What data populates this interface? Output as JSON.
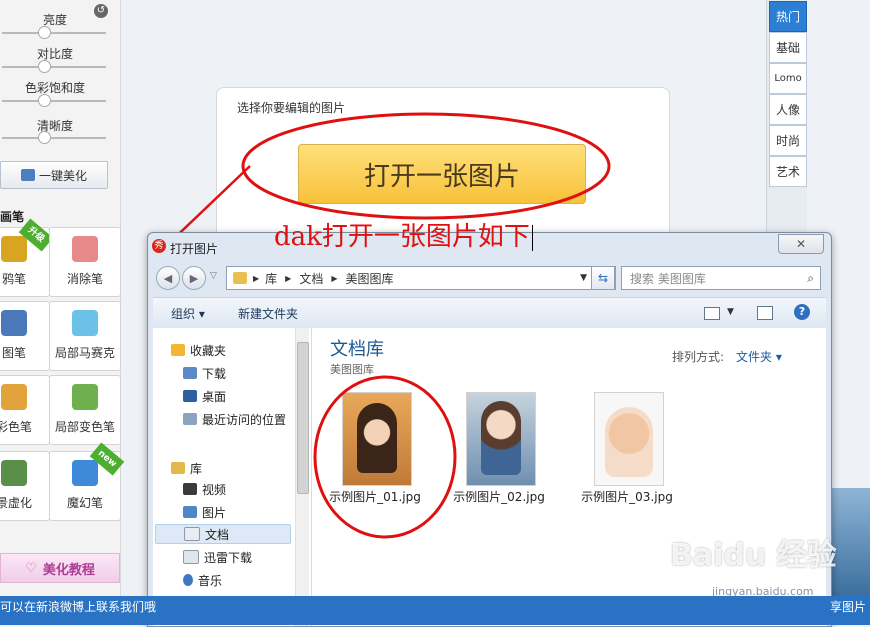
{
  "sliders": [
    {
      "label": "亮度",
      "level": 0.4
    },
    {
      "label": "对比度",
      "level": 0.4
    },
    {
      "label": "色彩饱和度",
      "level": 0.4
    },
    {
      "label": "清晰度",
      "level": 0.4
    }
  ],
  "onekey_label": "一键美化",
  "brush_title": "画笔",
  "tools": [
    {
      "label": "鸦笔",
      "badge": "升级",
      "color": "#d9a521"
    },
    {
      "label": "消除笔",
      "badge": "",
      "color": "#e88a8a"
    },
    {
      "label": "图笔",
      "badge": "",
      "color": "#4a78b8"
    },
    {
      "label": "局部马赛克",
      "badge": "",
      "color": "#6cc1e8"
    },
    {
      "label": "彩色笔",
      "badge": "",
      "color": "#e2a33c"
    },
    {
      "label": "局部变色笔",
      "badge": "",
      "color": "#6db04d"
    },
    {
      "label": "景虚化",
      "badge": "",
      "color": "#5a8f4a"
    },
    {
      "label": "魔幻笔",
      "badge": "new",
      "color": "#3f8ad8"
    }
  ],
  "tutorial_label": "美化教程",
  "right_tabs": [
    "热门",
    "基础",
    "Lomo",
    "人像",
    "时尚",
    "艺术"
  ],
  "card": {
    "prompt": "选择你要编辑的图片",
    "open_label": "打开一张图片"
  },
  "annotation": "dak打开一张图片如下",
  "bottom_bar_text": "可以在新浪微博上联系我们哦",
  "bottom_bar_right": "享图片",
  "dialog": {
    "title": "打开图片",
    "breadcrumb": [
      "库",
      "文档",
      "美图图库"
    ],
    "search_placeholder": "搜索 美图图库",
    "toolbar": {
      "organize": "组织",
      "new_folder": "新建文件夹"
    },
    "nav": {
      "favorites": "收藏夹",
      "fav_items": [
        "下载",
        "桌面",
        "最近访问的位置"
      ],
      "libraries": "库",
      "lib_items": [
        "视频",
        "图片",
        "文档",
        "迅雷下载",
        "音乐"
      ]
    },
    "library_title": "文档库",
    "library_sub": "美图图库",
    "sort_label": "排列方式:",
    "sort_value": "文件夹",
    "files": [
      "示例图片_01.jpg",
      "示例图片_02.jpg",
      "示例图片_03.jpg"
    ]
  },
  "watermark": "Baidu 经验",
  "watermark_url": "jingyan.baidu.com",
  "colors": {
    "accent_red": "#e01010",
    "tab_active": "#2d7fd3",
    "bar_blue": "#2a73c4"
  }
}
